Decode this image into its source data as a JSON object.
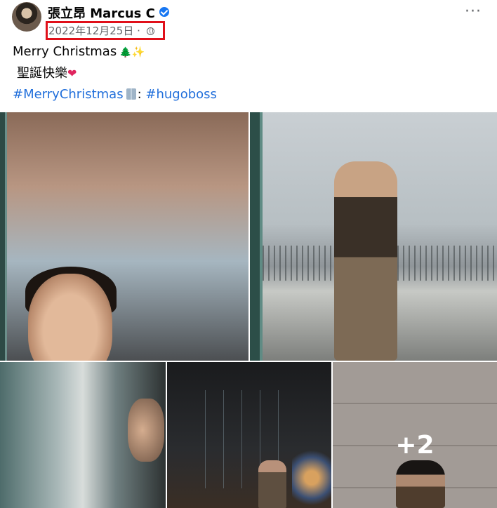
{
  "post": {
    "author": "張立昂 Marcus C",
    "date": "2022年12月25日",
    "separator": "·",
    "more_options": "···",
    "text_line1": "Merry Christmas",
    "emoji_tree": "🌲",
    "emoji_sparkles": "✨",
    "text_line2": "聖誕快樂",
    "emoji_heart": "❤",
    "hashtag1": "#MerryChristmas",
    "office_icon": "office-building-icon",
    "hashtag_separator": ":",
    "hashtag2": "#hugoboss"
  },
  "gallery": {
    "photo_count": 7,
    "more_count_label": "+2"
  },
  "colors": {
    "link": "#216fdb",
    "verified": "#1877f2",
    "highlight_box": "#e0101a",
    "meta_text": "#65676b"
  }
}
